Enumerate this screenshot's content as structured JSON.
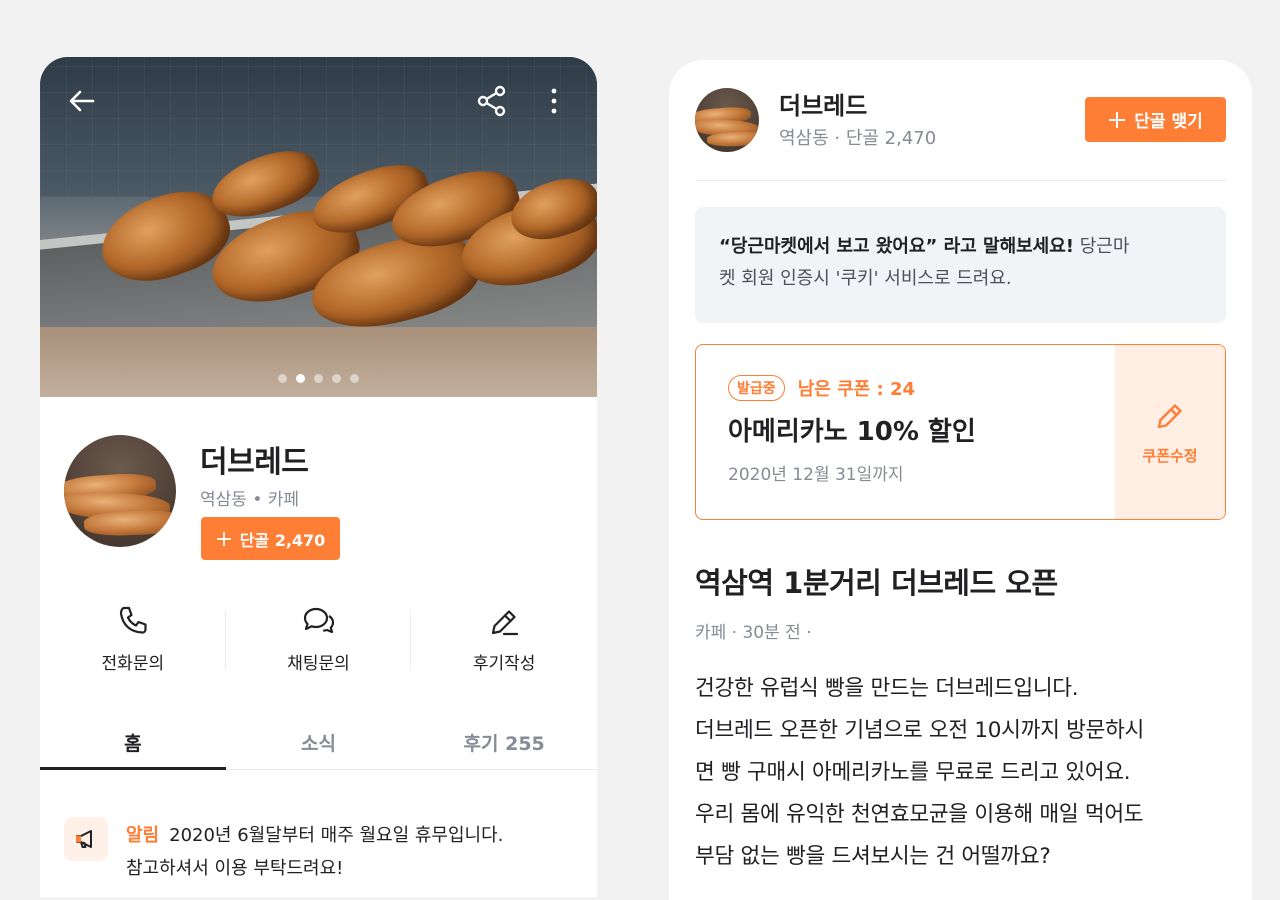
{
  "left": {
    "gallery": {
      "total": 5,
      "active_index": 1
    },
    "shop": {
      "name": "더브레드",
      "meta": "역삼동 • 카페",
      "regular_button": "단골 2,470"
    },
    "actions": [
      {
        "label": "전화문의",
        "icon": "phone-icon"
      },
      {
        "label": "채팅문의",
        "icon": "chat-icon"
      },
      {
        "label": "후기작성",
        "icon": "pencil-icon"
      }
    ],
    "tabs": [
      {
        "label": "홈",
        "active": true
      },
      {
        "label": "소식",
        "active": false
      },
      {
        "label": "후기 255",
        "active": false
      }
    ],
    "notice": {
      "tag": "알림",
      "line1": "2020년 6월달부터 매주 월요일 휴무입니다.",
      "line2": "참고하셔서 이용 부탁드려요!"
    }
  },
  "right": {
    "header": {
      "name": "더브레드",
      "meta": "역삼동 · 단골 2,470",
      "join_button": "단골 맺기"
    },
    "quote": {
      "bold": "“당근마켓에서 보고 왔어요” 라고 말해보세요!",
      "rest_line1": " 당근마",
      "line2": "켓 회원 인증시 '쿠키' 서비스로 드려요."
    },
    "coupon": {
      "badge": "발급중",
      "remaining": "남은 쿠폰 : 24",
      "title": "아메리카노 10% 할인",
      "expiry": "2020년 12월 31일까지",
      "edit_label": "쿠폰수정"
    },
    "post": {
      "title": "역삼역 1분거리 더브레드 오픈",
      "meta": "카페 · 30분 전 ·",
      "lines": [
        "건강한 유럽식 빵을 만드는 더브레드입니다.",
        "더브레드 오픈한 기념으로 오전 10시까지 방문하시",
        "면 빵 구매시 아메리카노를 무료로 드리고 있어요.",
        "우리 몸에 유익한 천연효모균을 이용해 매일 먹어도",
        "부담 없는 빵을 드셔보시는 건 어떨까요?"
      ]
    }
  },
  "colors": {
    "accent": "#ff7e36",
    "text": "#212124",
    "muted": "#868b94",
    "bg": "#f2f2f2"
  }
}
